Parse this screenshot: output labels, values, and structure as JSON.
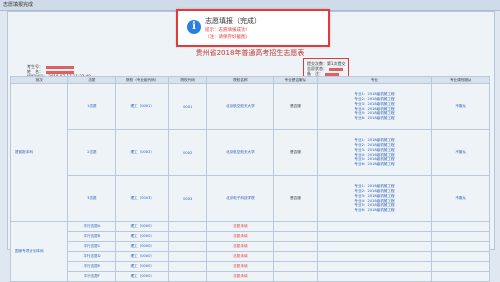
{
  "window": {
    "title": "志愿填报完成"
  },
  "dialog": {
    "icon": "info-icon",
    "title": "志愿填报（完成）",
    "line1": "提示：志愿填报成功!",
    "line2": "（注：请保存好截图）"
  },
  "page": {
    "title": "贵州省2018年普通高考招生志愿表"
  },
  "student": {
    "exam_label": "考生号：",
    "name_label": "姓　名：",
    "date_label": "填报时间：",
    "date_value": "2018-07-17 11:33:40"
  },
  "confirm": {
    "line1_label": "提交次数：",
    "line1_value": "第1次提交",
    "line2_label": "志愿状态：",
    "line3_label": "备　注："
  },
  "table": {
    "headers": [
      "批次",
      "志愿",
      "院校（专业组代码）",
      "院校代码",
      "院校名称",
      "专业是否服从",
      "专业",
      "专业调剂服从"
    ],
    "section1": {
      "name": "提前批本科",
      "rows": [
        {
          "vol": "1志愿",
          "group": "理工（0001）",
          "code": "0001",
          "school": "北京航空航天大学",
          "obey": "是否服",
          "majors": [
            "专业1：2018级机械工程",
            "专业2：2018级机械工程",
            "专业3：2018级机械工程",
            "专业4：2018级机械工程",
            "专业5：2018级机械工程",
            "专业6：2018级机械工程"
          ],
          "adjust": "不服从"
        },
        {
          "vol": "2志愿",
          "group": "理工（0002）",
          "code": "0002",
          "school": "北京航空航天大学",
          "obey": "是否服",
          "majors": [
            "专业1：2018级机械工程",
            "专业2：2018级机械工程",
            "专业3：2018级机械工程",
            "专业4：2018级机械工程",
            "专业5：2018级机械工程",
            "专业6：2018级机械工程"
          ],
          "adjust": "不服从"
        },
        {
          "vol": "3志愿",
          "group": "理工（0003）",
          "code": "0003",
          "school": "北京电子科技学院",
          "obey": "是否服",
          "majors": [
            "专业1：2018级机械工程",
            "专业2：2018级机械工程",
            "专业3：2018级机械工程",
            "专业4：2018级机械工程",
            "专业5：2018级机械工程",
            "专业6：2018级机械工程"
          ],
          "adjust": "不服从"
        }
      ]
    },
    "section2": {
      "name": "国家专项计划本科",
      "rows": [
        {
          "vol": "平行志愿A",
          "group": "理工（0000）",
          "status": "志愿未填"
        },
        {
          "vol": "平行志愿B",
          "group": "理工（0000）",
          "status": "志愿未填"
        },
        {
          "vol": "平行志愿C",
          "group": "理工（0000）",
          "status": "志愿未填"
        },
        {
          "vol": "平行志愿D",
          "group": "理工（0000）",
          "status": "志愿未填"
        },
        {
          "vol": "平行志愿E",
          "group": "理工（0000）",
          "status": "志愿未填"
        },
        {
          "vol": "平行志愿F",
          "group": "理工（0000）",
          "status": "志愿未填"
        }
      ]
    }
  },
  "colors": {
    "accent_red": "#e23a3a",
    "link_blue": "#2a5db0",
    "info_blue": "#2a7fe0"
  }
}
